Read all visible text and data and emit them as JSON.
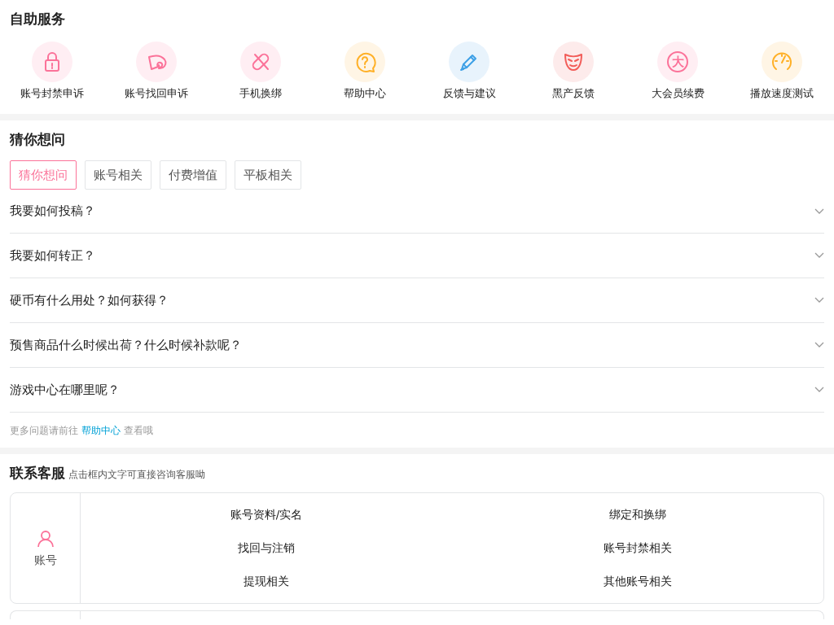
{
  "self_service": {
    "title": "自助服务",
    "items": [
      {
        "label": "账号封禁申诉",
        "color": "#fb7299"
      },
      {
        "label": "账号找回申诉",
        "color": "#fb7299"
      },
      {
        "label": "手机换绑",
        "color": "#fb7299"
      },
      {
        "label": "帮助中心",
        "color": "#ffb027"
      },
      {
        "label": "反馈与建议",
        "color": "#3ea0e6"
      },
      {
        "label": "黑产反馈",
        "color": "#f25d59"
      },
      {
        "label": "大会员续费",
        "color": "#fb7299",
        "glyph": "大"
      },
      {
        "label": "播放速度测试",
        "color": "#ffb027"
      }
    ]
  },
  "faq": {
    "title": "猜你想问",
    "tabs": [
      {
        "label": "猜你想问",
        "selected": true
      },
      {
        "label": "账号相关",
        "selected": false
      },
      {
        "label": "付费增值",
        "selected": false
      },
      {
        "label": "平板相关",
        "selected": false
      }
    ],
    "questions": [
      {
        "text": "我要如何投稿？",
        "expanded": false
      },
      {
        "text": "我要如何转正？",
        "expanded": false
      },
      {
        "text": "硬币有什么用处？如何获得？",
        "expanded": false
      },
      {
        "text": "预售商品什么时候出荷？什么时候补款呢？",
        "expanded": false
      },
      {
        "text": "游戏中心在哪里呢？",
        "expanded": false
      }
    ],
    "footer": {
      "before": "更多问题请前往",
      "link": "帮助中心",
      "after": "查看哦"
    }
  },
  "contact": {
    "title": "联系客服",
    "subtitle": "点击框内文字可直接咨询客服呦",
    "groups": [
      {
        "name": "账号",
        "topics": [
          "账号资料/实名",
          "绑定和换绑",
          "找回与注销",
          "账号封禁相关",
          "提现相关",
          "其他账号相关"
        ]
      },
      {
        "kind": "partial"
      }
    ]
  }
}
